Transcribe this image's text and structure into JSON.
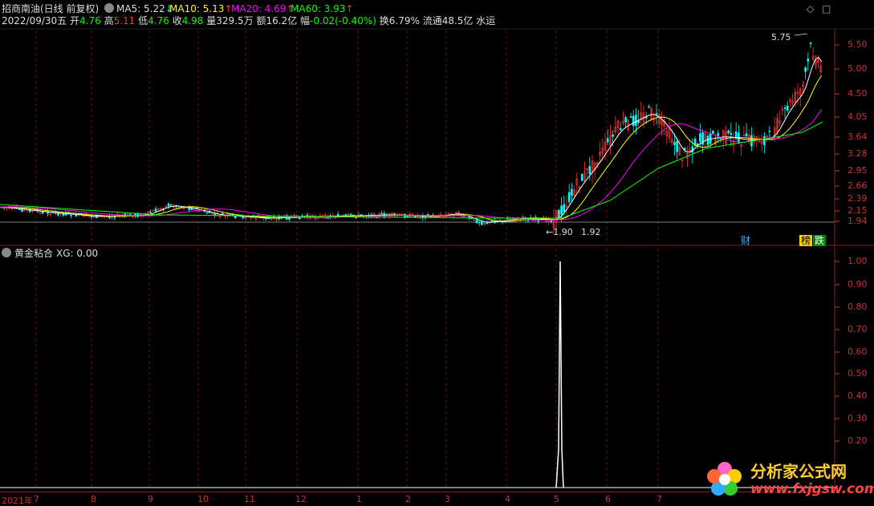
{
  "header": {
    "stock_name": "招商南油(日线 前复权)",
    "ma5": "MA5: 5.22",
    "ma10": "MA10: 5.13",
    "ma20": "MA20: 4.69",
    "ma60": "MA60: 3.93",
    "down_arrow": "↓",
    "up_arrow": "↑"
  },
  "quote": {
    "date": "2022/09/30五",
    "open_label": "开",
    "open": "4.76",
    "high_label": "高",
    "high": "5.11",
    "low_label": "低",
    "low": "4.76",
    "close_label": "收",
    "close": "4.98",
    "vol_label": "量",
    "vol": "329.5万",
    "amt_label": "额",
    "amt": "16.2亿",
    "chg_label": "幅",
    "chg": "-0.02(-0.40%)",
    "turn": "换6.79%",
    "float": "流通48.5亿",
    "sector": "水运"
  },
  "annotations": {
    "peak": "5.75",
    "low1": "1.90",
    "low2": "1.92"
  },
  "price_axis": [
    "5.50",
    "5.00",
    "4.50",
    "4.05",
    "3.64",
    "3.28",
    "2.95",
    "2.66",
    "2.39",
    "2.15",
    "1.94"
  ],
  "badges": {
    "cai": "财",
    "bang": "榜",
    "die": "跌"
  },
  "indicator": {
    "name": "黄金粘合",
    "xg": "XG: 0.00",
    "axis": [
      "1.00",
      "0.90",
      "0.80",
      "0.70",
      "0.60",
      "0.50",
      "0.40",
      "0.30",
      "0.20"
    ]
  },
  "dates": [
    "2021年",
    "7",
    "8",
    "9",
    "10",
    "11",
    "12",
    "1",
    "2",
    "3",
    "4",
    "5",
    "6",
    "7"
  ],
  "watermark": {
    "cn": "分析家公式网",
    "url": "www.fxjgsw.com"
  },
  "colors": {
    "ma5": "#ffffff",
    "ma10": "#ffff00",
    "ma20": "#ff00ff",
    "ma60": "#00ff00",
    "up": "#ff3333",
    "down": "#00ffff",
    "frame": "#8b1a1a"
  }
}
